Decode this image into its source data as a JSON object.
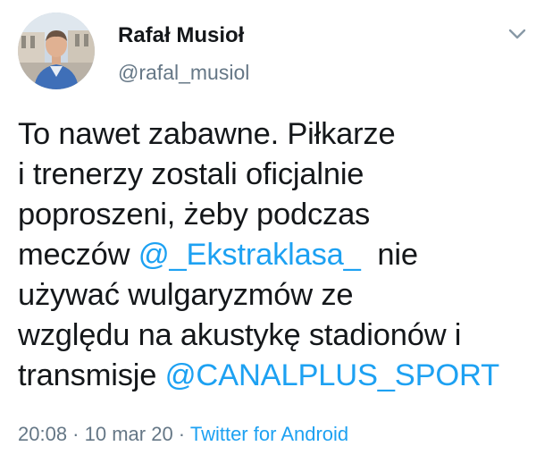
{
  "tweet": {
    "author": {
      "name": "Rafał Musioł",
      "handle": "@rafal_musiol"
    },
    "text": {
      "line1": "To nawet zabawne. Piłkarze",
      "line2": "i trenerzy zostali oficjalnie",
      "line3": "poproszeni, żeby podczas",
      "line4_pre": "meczów ",
      "mention1": "@_Ekstraklasa_",
      "line4_post": "  nie",
      "line5": "używać wulgaryzmów ze",
      "line6": "względu na akustykę stadionów i",
      "line7_pre": "transmisje ",
      "mention2": "@CANALPLUS_SPORT"
    },
    "meta": {
      "time": "20:08",
      "sep1": " · ",
      "date": "10 mar 20",
      "sep2": " · ",
      "source": "Twitter for Android"
    },
    "colors": {
      "link": "#1da1f2",
      "secondary": "#657786",
      "text": "#14171a"
    },
    "icons": {
      "menu": "chevron-down-icon",
      "avatar": "profile-photo"
    }
  }
}
